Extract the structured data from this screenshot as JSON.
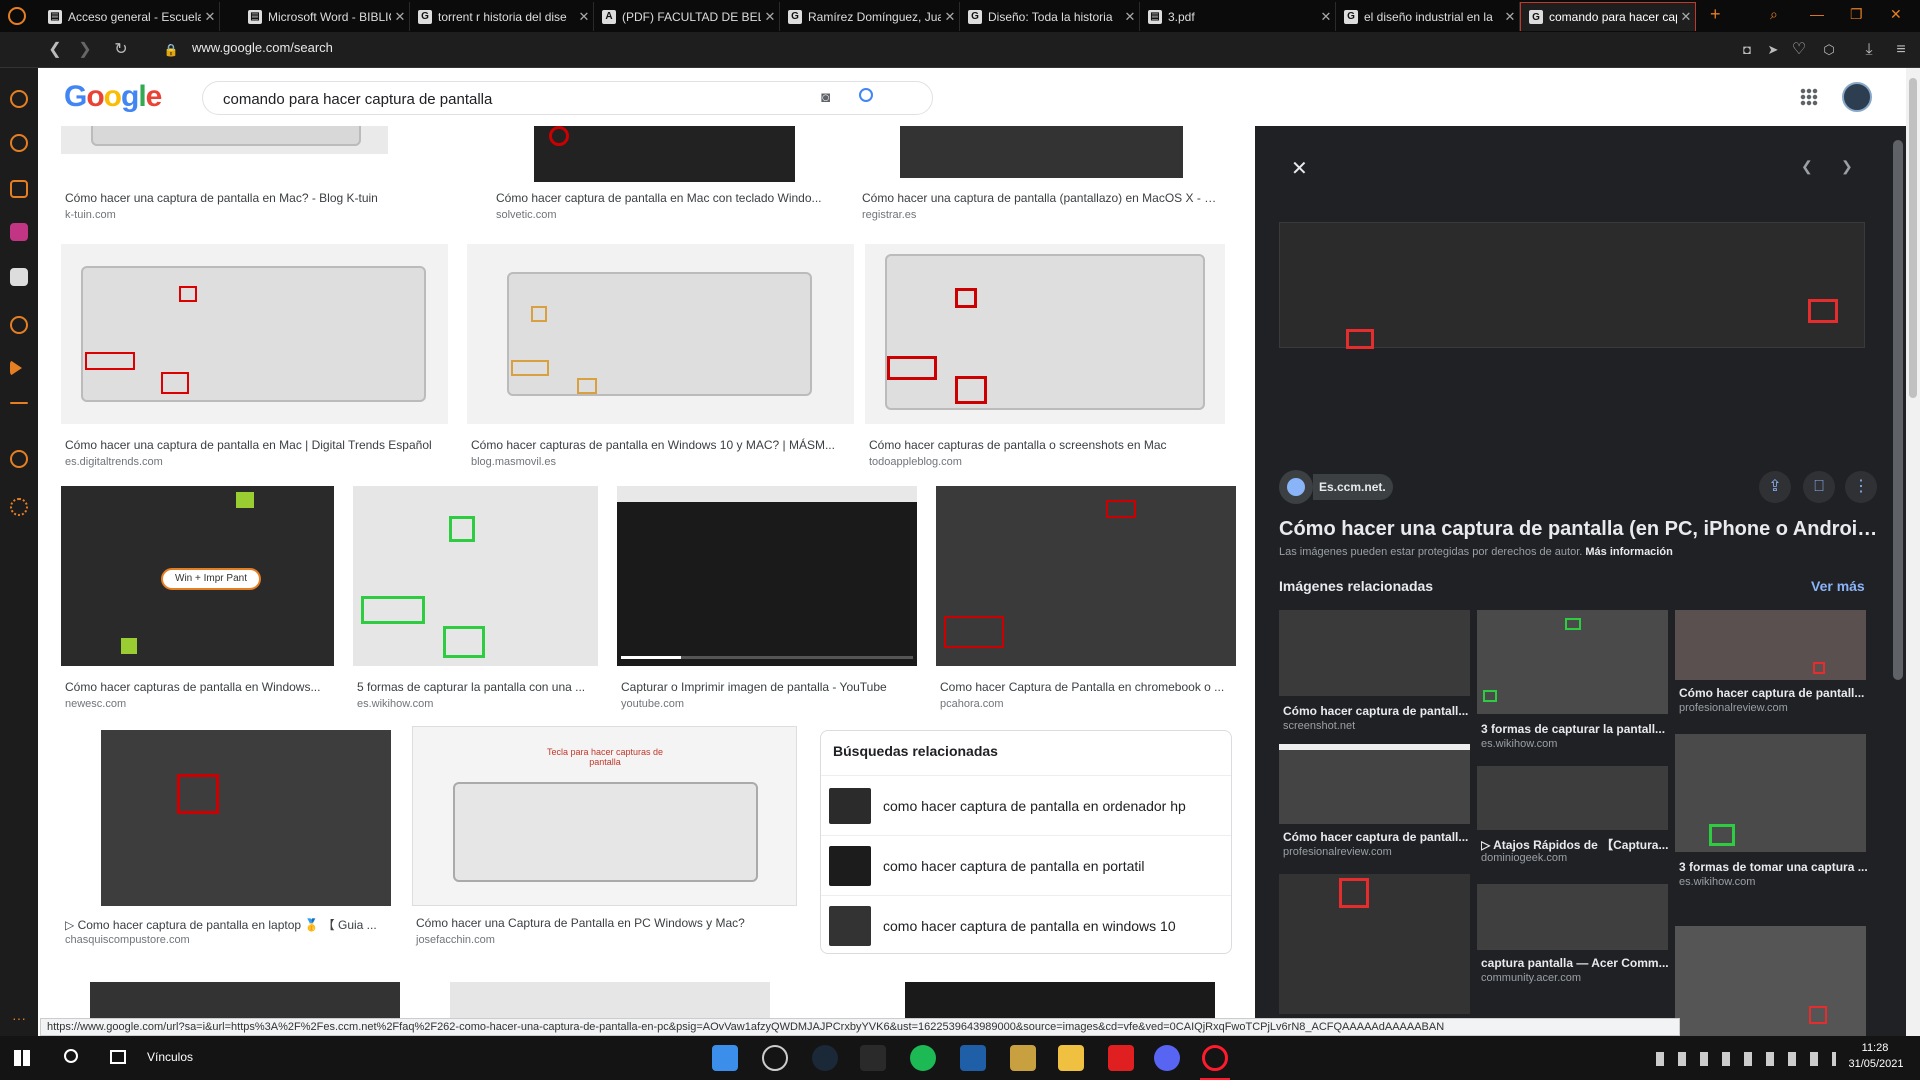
{
  "browser": {
    "tabs": [
      {
        "label": "Acceso general - Escuela",
        "icon": "document-icon"
      },
      {
        "label": "Microsoft Word - BIBLIO",
        "icon": "document-icon"
      },
      {
        "label": "torrent r historia del dise",
        "icon": "google-icon"
      },
      {
        "label": "(PDF) FACULTAD DE BELL",
        "icon": "academia-icon"
      },
      {
        "label": "Ramírez Domínguez, Jua",
        "icon": "google-icon"
      },
      {
        "label": "Diseño: Toda la historia",
        "icon": "google-icon"
      },
      {
        "label": "3.pdf",
        "icon": "document-icon"
      },
      {
        "label": "el diseño industrial en la",
        "icon": "google-icon"
      },
      {
        "label": "comando para hacer cap",
        "icon": "google-icon"
      }
    ],
    "new_tab": "+",
    "url": "www.google.com/search",
    "status_url": "https://www.google.com/url?sa=i&url=https%3A%2F%2Fes.ccm.net%2Ffaq%2F262-como-hacer-una-captura-de-pantalla-en-pc&psig=AOvVaw1afzyQWDMJAJPCrxbyYVK6&ust=1622539643989000&source=images&cd=vfe&ved=0CAIQjRxqFwoTCPjLv6rN8_ACFQAAAAAdAAAAABAN"
  },
  "google": {
    "logo": "Google",
    "query": "comando para hacer captura de pantalla"
  },
  "results": [
    {
      "caption": "Cómo hacer una captura de pantalla en Mac? - Blog K-tuin",
      "source": "k-tuin.com"
    },
    {
      "caption": "Cómo hacer captura de pantalla en Mac con teclado Windo...",
      "source": "solvetic.com"
    },
    {
      "caption": "Cómo hacer una captura de pantalla (pantallazo) en MacOS X - R...",
      "source": "registrar.es"
    },
    {
      "caption": "Cómo hacer una captura de pantalla en Mac | Digital Trends Español",
      "source": "es.digitaltrends.com"
    },
    {
      "caption": "Cómo hacer capturas de pantalla en Windows 10 y MAC? | MÁSM...",
      "source": "blog.masmovil.es"
    },
    {
      "caption": "Cómo hacer capturas de pantalla o screenshots en Mac",
      "source": "todoappleblog.com"
    },
    {
      "caption": "Cómo hacer capturas de pantalla en Windows...",
      "source": "newesc.com",
      "overlay": "Win + Impr Pant"
    },
    {
      "caption": "5 formas de capturar la pantalla con una ...",
      "source": "es.wikihow.com"
    },
    {
      "caption": "Capturar o Imprimir imagen de pantalla - YouTube",
      "source": "youtube.com"
    },
    {
      "caption": "Como hacer Captura de Pantalla en chromebook o ...",
      "source": "pcahora.com"
    },
    {
      "caption": "▷ Como hacer captura de pantalla en laptop 🥇 【 Guia ...",
      "source": "chasquiscompustore.com"
    },
    {
      "caption": "Cómo hacer una Captura de Pantalla en PC Windows y Mac?",
      "source": "josefacchin.com",
      "overlay": "Tecla para hacer capturas de pantalla"
    }
  ],
  "related_searches": {
    "title": "Búsquedas relacionadas",
    "items": [
      "como hacer captura de pantalla en ordenador hp",
      "como hacer captura de pantalla en portatil",
      "como hacer captura de pantalla en windows 10"
    ]
  },
  "panel": {
    "source": "Es.ccm.net.",
    "title": "Cómo hacer una captura de pantalla (en PC, iPhone o Android) - ...",
    "copyright": "Las imágenes pueden estar protegidas por derechos de autor.",
    "more_info": "Más información",
    "related_title": "Imágenes relacionadas",
    "see_more": "Ver más",
    "related": [
      {
        "caption": "Cómo hacer captura de pantall...",
        "source": "screenshot.net"
      },
      {
        "caption": "3 formas de capturar la pantall...",
        "source": "es.wikihow.com"
      },
      {
        "caption": "Cómo hacer captura de pantall...",
        "source": "profesionalreview.com"
      },
      {
        "caption": "Cómo hacer captura de pantall...",
        "source": "profesionalreview.com"
      },
      {
        "caption": "▷ Atajos Rápidos de 【Captura...",
        "source": "dominiogeek.com"
      },
      {
        "caption": "3 formas de tomar una captura ...",
        "source": "es.wikihow.com"
      },
      {
        "caption": "captura pantalla — Acer Comm...",
        "source": "community.acer.com"
      }
    ]
  },
  "taskbar": {
    "links_label": "Vínculos",
    "time": "11:28",
    "date": "31/05/2021"
  }
}
